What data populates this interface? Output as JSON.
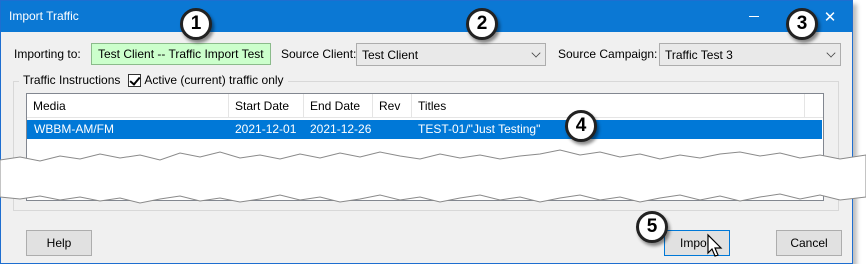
{
  "window": {
    "title": "Import Traffic"
  },
  "form": {
    "importing_label": "Importing to:",
    "importing_value": "Test Client -- Traffic Import Test",
    "source_client_label": "Source Client:",
    "source_client_value": "Test Client",
    "source_campaign_label": "Source Campaign:",
    "source_campaign_value": "Traffic Test 3"
  },
  "group": {
    "label": "Traffic Instructions",
    "checkbox_label": "Active (current) traffic only",
    "checkbox_checked": true
  },
  "table": {
    "headers": {
      "media": "Media",
      "start": "Start Date",
      "end": "End Date",
      "rev": "Rev",
      "titles": "Titles"
    },
    "rows": [
      {
        "media": "WBBM-AM/FM",
        "start": "2021-12-01",
        "end": "2021-12-26",
        "rev": "",
        "titles": "TEST-01/\"Just Testing\""
      }
    ]
  },
  "buttons": {
    "help": "Help",
    "import": "Import",
    "cancel": "Cancel"
  },
  "callouts": [
    "1",
    "2",
    "3",
    "4",
    "5"
  ],
  "colors": {
    "titlebar": "#0b78d4",
    "selection": "#0078d7",
    "importing_bg": "#ccffcc"
  }
}
